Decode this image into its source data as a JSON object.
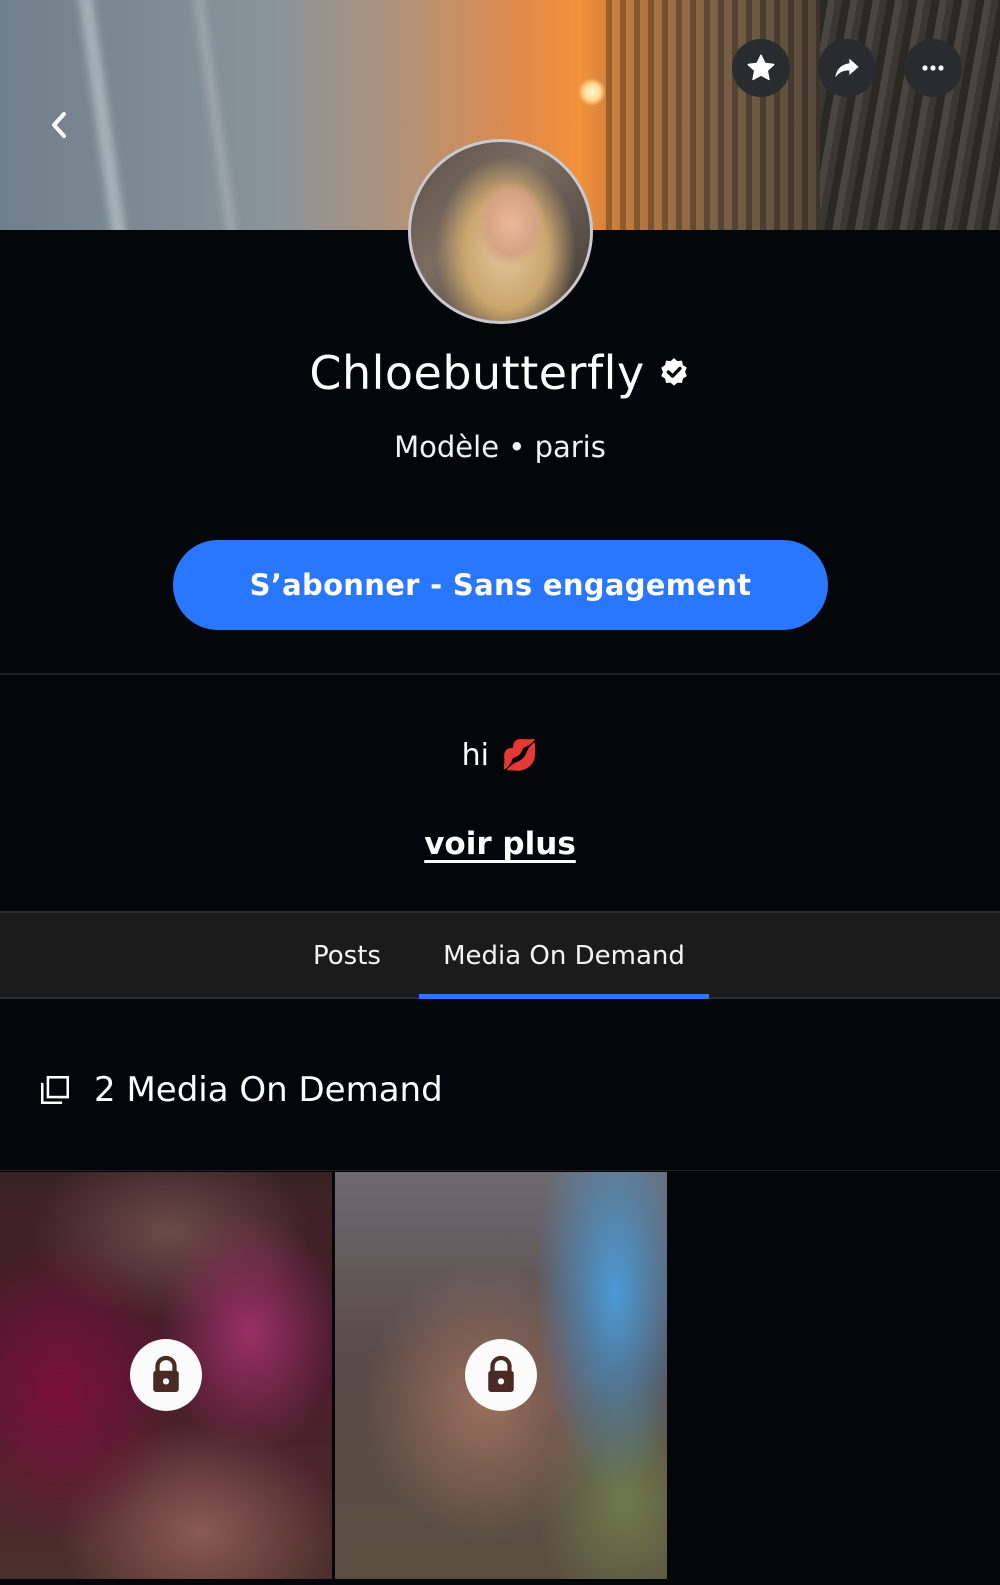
{
  "profile": {
    "name": "Chloebutterfly",
    "subtitle": "Modèle • paris",
    "bio_text": "hi",
    "bio_emoji": "💋",
    "more_link": "voir plus"
  },
  "actions": {
    "subscribe_label": "S’abonner - Sans engagement"
  },
  "tabs": [
    {
      "label": "Posts",
      "active": false
    },
    {
      "label": "Media On Demand",
      "active": true
    }
  ],
  "section": {
    "title": "2 Media On Demand"
  },
  "media": [
    {
      "locked": true
    },
    {
      "locked": true
    }
  ],
  "colors": {
    "accent": "#2a77ff",
    "background": "#05060a",
    "tab_bar": "#1b1b1c"
  }
}
